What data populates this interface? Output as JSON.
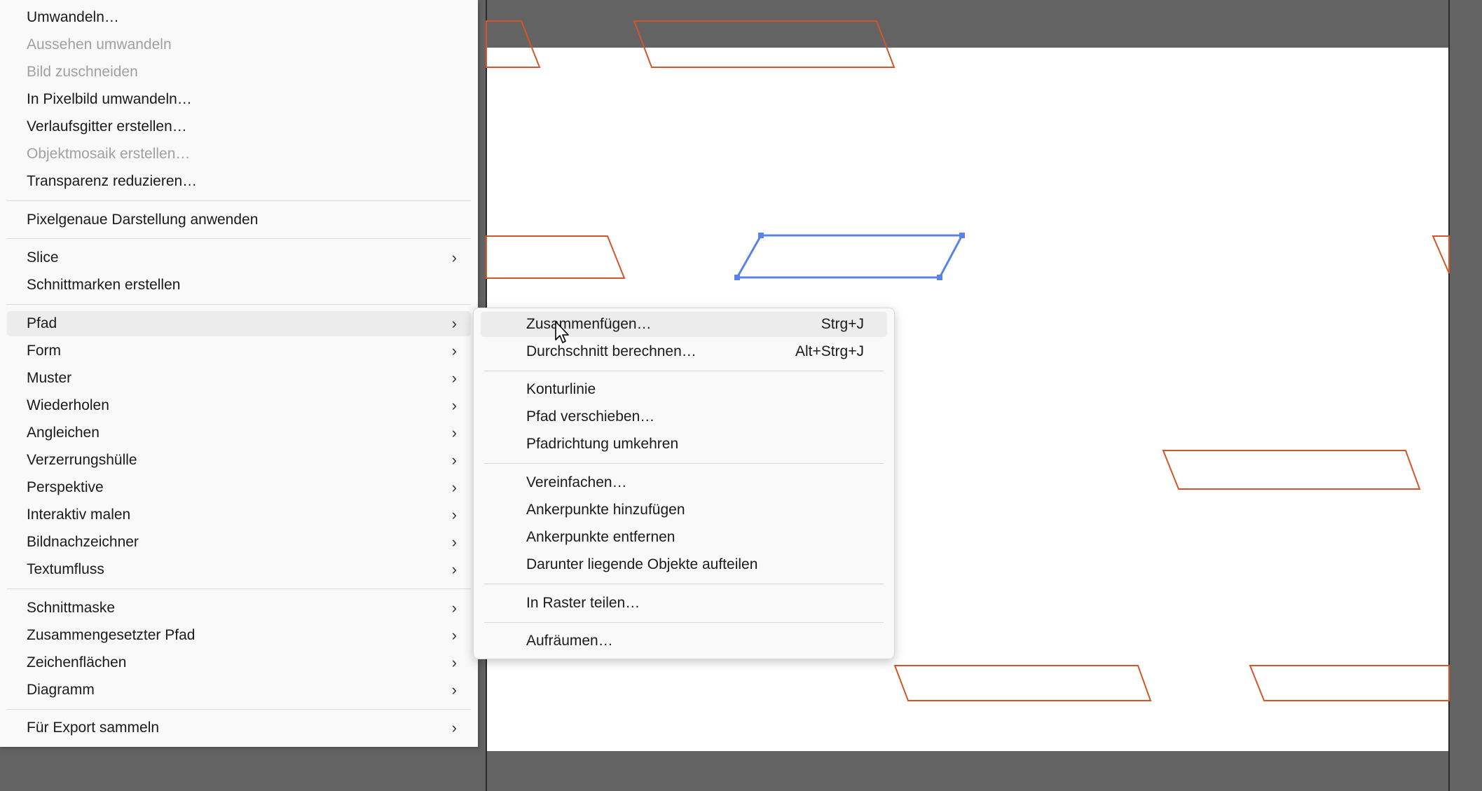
{
  "main_menu": {
    "items": [
      {
        "label": "Umwandeln…",
        "disabled": false,
        "submenu": false
      },
      {
        "label": "Aussehen umwandeln",
        "disabled": true,
        "submenu": false
      },
      {
        "label": "Bild zuschneiden",
        "disabled": true,
        "submenu": false
      },
      {
        "label": "In Pixelbild umwandeln…",
        "disabled": false,
        "submenu": false
      },
      {
        "label": "Verlaufsgitter erstellen…",
        "disabled": false,
        "submenu": false
      },
      {
        "label": "Objektmosaik erstellen…",
        "disabled": true,
        "submenu": false
      },
      {
        "label": "Transparenz reduzieren…",
        "disabled": false,
        "submenu": false
      },
      {
        "label": "Pixelgenaue Darstellung anwenden",
        "disabled": false,
        "submenu": false
      },
      {
        "label": "Slice",
        "disabled": false,
        "submenu": true
      },
      {
        "label": "Schnittmarken erstellen",
        "disabled": false,
        "submenu": false
      },
      {
        "label": "Pfad",
        "disabled": false,
        "submenu": true,
        "highlighted": true
      },
      {
        "label": "Form",
        "disabled": false,
        "submenu": true
      },
      {
        "label": "Muster",
        "disabled": false,
        "submenu": true
      },
      {
        "label": "Wiederholen",
        "disabled": false,
        "submenu": true
      },
      {
        "label": "Angleichen",
        "disabled": false,
        "submenu": true
      },
      {
        "label": "Verzerrungshülle",
        "disabled": false,
        "submenu": true
      },
      {
        "label": "Perspektive",
        "disabled": false,
        "submenu": true
      },
      {
        "label": "Interaktiv malen",
        "disabled": false,
        "submenu": true
      },
      {
        "label": "Bildnachzeichner",
        "disabled": false,
        "submenu": true
      },
      {
        "label": "Textumfluss",
        "disabled": false,
        "submenu": true
      },
      {
        "label": "Schnittmaske",
        "disabled": false,
        "submenu": true
      },
      {
        "label": "Zusammengesetzter Pfad",
        "disabled": false,
        "submenu": true
      },
      {
        "label": "Zeichenflächen",
        "disabled": false,
        "submenu": true
      },
      {
        "label": "Diagramm",
        "disabled": false,
        "submenu": true
      },
      {
        "label": "Für Export sammeln",
        "disabled": false,
        "submenu": true
      }
    ]
  },
  "path_submenu": {
    "items": [
      {
        "label": "Zusammenfügen…",
        "shortcut": "Strg+J",
        "highlighted": true
      },
      {
        "label": "Durchschnitt berechnen…",
        "shortcut": "Alt+Strg+J"
      },
      {
        "label": "Konturlinie",
        "shortcut": ""
      },
      {
        "label": "Pfad verschieben…",
        "shortcut": ""
      },
      {
        "label": "Pfadrichtung umkehren",
        "shortcut": ""
      },
      {
        "label": "Vereinfachen…",
        "shortcut": ""
      },
      {
        "label": "Ankerpunkte hinzufügen",
        "shortcut": ""
      },
      {
        "label": "Ankerpunkte entfernen",
        "shortcut": ""
      },
      {
        "label": "Darunter liegende Objekte aufteilen",
        "shortcut": ""
      },
      {
        "label": "In Raster teilen…",
        "shortcut": ""
      },
      {
        "label": "Aufräumen…",
        "shortcut": ""
      }
    ]
  },
  "icons": {
    "submenu_arrow": "chevron-right-icon",
    "pointer": "mouse-pointer-icon"
  },
  "colors": {
    "shape_stroke": "#d4552a",
    "selection": "#5b83e6",
    "pasteboard": "#636363",
    "artboard": "#ffffff",
    "menu_bg": "#f9f9f9",
    "menu_highlight": "#ececec",
    "disabled_text": "#a0a0a0"
  }
}
